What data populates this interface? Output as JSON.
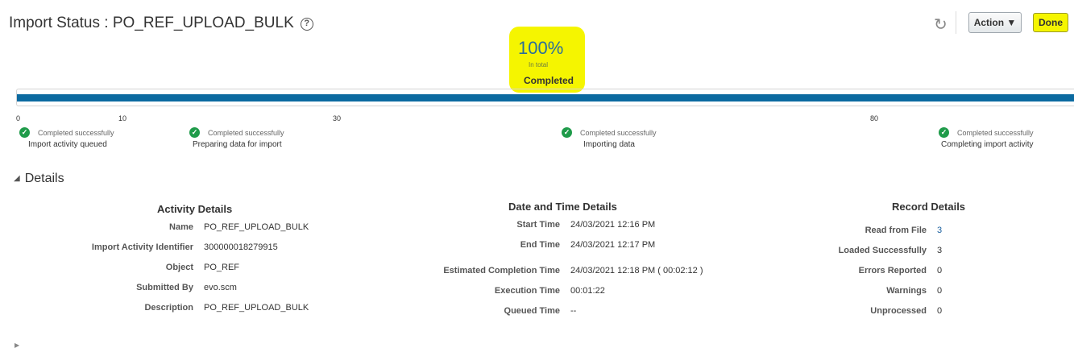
{
  "header": {
    "title": "Import Status : PO_REF_UPLOAD_BULK",
    "help_icon": "?",
    "action_label": "Action ▼",
    "done_label": "Done"
  },
  "progress": {
    "percent_text": "100%",
    "percent_value": 100,
    "in_total_text": "In total",
    "status_text": "Completed",
    "ticks": [
      "0",
      "10",
      "30",
      "80"
    ]
  },
  "milestones": [
    {
      "status": "Completed successfully",
      "label": "Import activity queued"
    },
    {
      "status": "Completed successfully",
      "label": "Preparing data for import"
    },
    {
      "status": "Completed successfully",
      "label": "Importing data"
    },
    {
      "status": "Completed successfully",
      "label": "Completing import activity"
    }
  ],
  "details": {
    "toggle_label": "Details",
    "activity": {
      "title": "Activity Details",
      "rows": [
        {
          "label": "Name",
          "value": "PO_REF_UPLOAD_BULK"
        },
        {
          "label": "Import Activity Identifier",
          "value": "300000018279915"
        },
        {
          "label": "Object",
          "value": "PO_REF"
        },
        {
          "label": "Submitted By",
          "value": "evo.scm"
        },
        {
          "label": "Description",
          "value": "PO_REF_UPLOAD_BULK"
        }
      ]
    },
    "datetime": {
      "title": "Date and Time Details",
      "rows": [
        {
          "label": "Start Time",
          "value": "24/03/2021 12:16 PM"
        },
        {
          "label": "End Time",
          "value": "24/03/2021 12:17 PM"
        },
        {
          "label": "Estimated Completion Time",
          "value": "24/03/2021 12:18 PM ( 00:02:12 )"
        },
        {
          "label": "Execution Time",
          "value": "00:01:22"
        },
        {
          "label": "Queued Time",
          "value": "--"
        }
      ]
    },
    "records": {
      "title": "Record Details",
      "rows": [
        {
          "label": "Read from File",
          "value": "3"
        },
        {
          "label": "Loaded Successfully",
          "value": "3"
        },
        {
          "label": "Errors Reported",
          "value": "0"
        },
        {
          "label": "Warnings",
          "value": "0"
        },
        {
          "label": "Unprocessed",
          "value": "0"
        }
      ]
    }
  },
  "colors": {
    "progress_fill": "#0b6aa0",
    "highlight": "#f5f500",
    "success": "#1f9b4a",
    "link": "#1a5f9e"
  }
}
